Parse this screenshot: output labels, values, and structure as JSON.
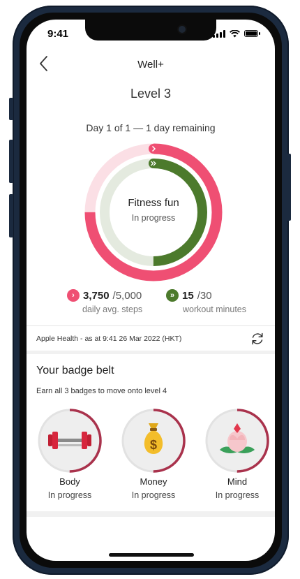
{
  "status_bar": {
    "time": "9:41"
  },
  "nav": {
    "title": "Well+"
  },
  "level": {
    "title": "Level 3",
    "day_text": "Day 1 of 1 — 1 day remaining"
  },
  "ring": {
    "title": "Fitness fun",
    "status": "In progress",
    "steps_progress": 0.75,
    "workout_progress": 0.5
  },
  "metrics": {
    "steps": {
      "value": "3,750",
      "total": "/5,000",
      "label": "daily avg. steps"
    },
    "workout": {
      "value": "15",
      "total": "/30",
      "label": "workout minutes"
    }
  },
  "source": {
    "text": "Apple Health - as at 9:41 26 Mar 2022 (HKT)"
  },
  "badge_belt": {
    "title": "Your badge belt",
    "subtitle": "Earn all 3 badges to move onto level 4",
    "badges": [
      {
        "name": "Body",
        "status": "In progress",
        "icon": "dumbbell-icon",
        "progress": 0.5
      },
      {
        "name": "Money",
        "status": "In progress",
        "icon": "money-bag-icon",
        "progress": 0.5
      },
      {
        "name": "Mind",
        "status": "In progress",
        "icon": "lotus-icon",
        "progress": 0.5
      }
    ]
  },
  "colors": {
    "pink": "#ef4f73",
    "light_pink": "#fbdfe5",
    "green": "#4c7a2c",
    "light_green": "#e4eadf",
    "maroon": "#a9324c"
  }
}
